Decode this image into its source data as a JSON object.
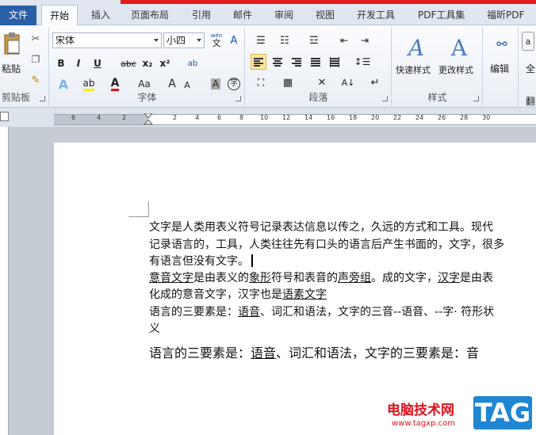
{
  "tabs": {
    "file": "文件",
    "items": [
      "开始",
      "插入",
      "页面布局",
      "引用",
      "邮件",
      "审阅",
      "视图",
      "开发工具",
      "PDF工具集",
      "福昕PDF"
    ]
  },
  "ribbon": {
    "clipboard": {
      "paste": "粘贴",
      "label": "剪贴板"
    },
    "font": {
      "name": "宋体",
      "size": "小四",
      "phonetic": "wén",
      "label": "字体",
      "bold": "B",
      "italic": "I",
      "underline": "U",
      "strike": "abc",
      "sub": "x₂",
      "sup": "x²",
      "grow": "A",
      "shrink": "A",
      "size_aa": "Aa",
      "circle_char": "字",
      "font_color": "A",
      "char_shade": "A"
    },
    "paragraph": {
      "label": "段落"
    },
    "styles": {
      "quick": "快速样式",
      "change": "更改样式",
      "label": "样式"
    },
    "editing": {
      "label": "编辑"
    },
    "extra": {
      "top": "全",
      "bottom": "翻"
    }
  },
  "ruler": {
    "ticks": [
      "6",
      "4",
      "2",
      "2",
      "4",
      "6",
      "8",
      "10",
      "12",
      "14",
      "16",
      "18",
      "20",
      "22",
      "24",
      "26",
      "28",
      "30"
    ]
  },
  "document": {
    "p1_line1": "文字是人类用表义符号记录表达信息以传之，久远的方式和工具。现代",
    "p1_line2": "记录语言的，工具，人类往往先有口头的语言后产生书面的，文字，很多",
    "p1_line3": "有语言但没有文字。",
    "p2_a": "意音文字",
    "p2_b": "是由表义的",
    "p2_c": "象形",
    "p2_d": "符号和表音的",
    "p2_e": "声旁组",
    "p2_f": "。成的文字，",
    "p2_g": "汉字",
    "p2_h": "是由表",
    "p2_line2_a": "化成的意音文字，汉字也是",
    "p2_line2_b": "语素文字",
    "p3_a": "语言的三要素是：",
    "p3_b": "语音",
    "p3_c": "、词汇和语法，文字的三音--语音、--字· 符形状",
    "p3_line2": "义",
    "p4_a": "语言的三要素是：",
    "p4_b": "语音",
    "p4_c": "、词汇和语法，文字的三要素是：音"
  },
  "watermark": {
    "site": "电脑技术网",
    "url": "www.tagxp.com",
    "tag": "TAG"
  },
  "colors": {
    "file_tab": "#2a5ea8",
    "top_strip": "#e21b1b",
    "watermark_red": "#e0121c",
    "tag_blue": "#1f86d4"
  }
}
